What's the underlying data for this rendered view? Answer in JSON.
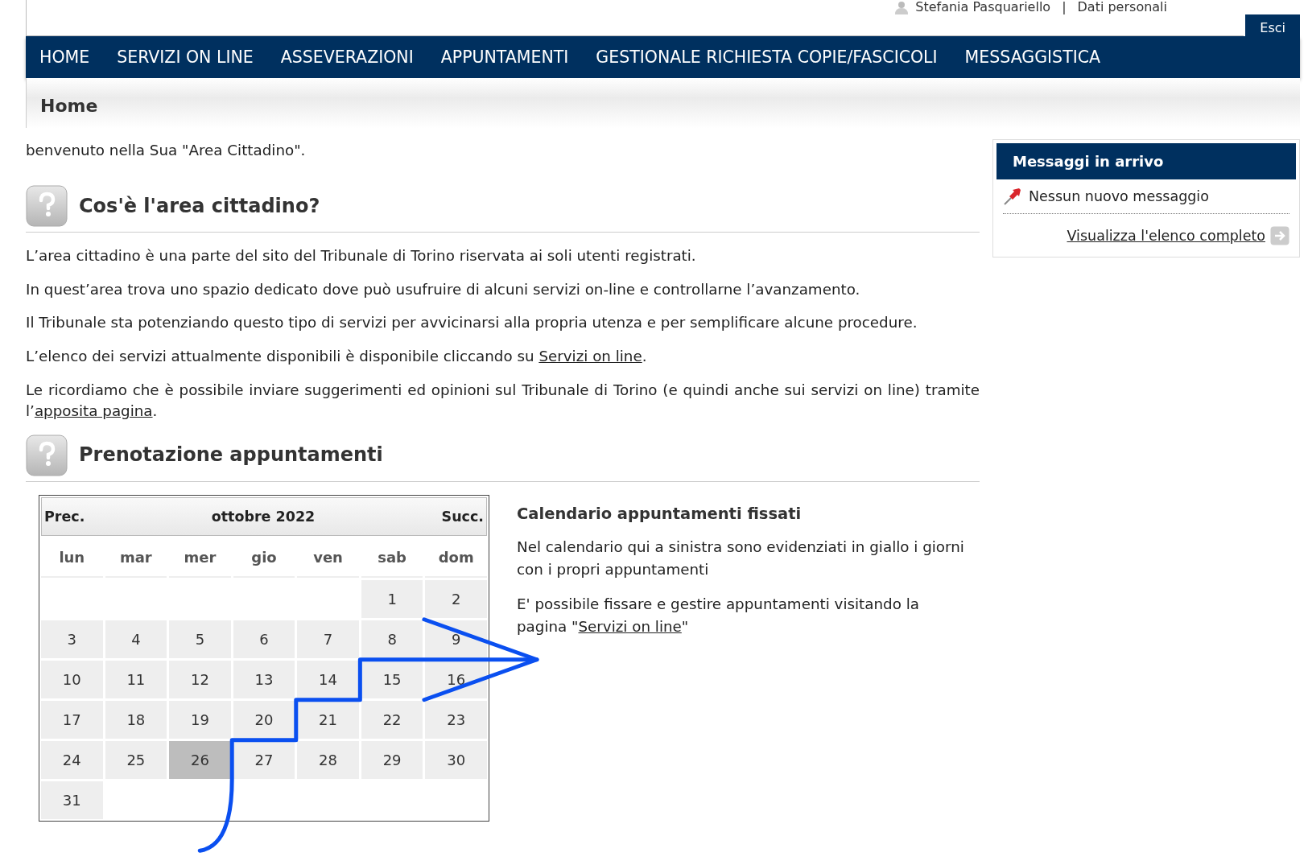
{
  "user_bar": {
    "user": "Stefania Pasquariello",
    "separator": "|",
    "link": "Dati personali",
    "logout": "Esci"
  },
  "nav": [
    {
      "label": "HOME"
    },
    {
      "label": "SERVIZI ON LINE"
    },
    {
      "label": "ASSEVERAZIONI"
    },
    {
      "label": "APPUNTAMENTI"
    },
    {
      "label": "GESTIONALE RICHIESTA COPIE/FASCICOLI"
    },
    {
      "label": "MESSAGGISTICA"
    }
  ],
  "page_title": "Home",
  "welcome": "benvenuto nella Sua \"Area Cittadino\".",
  "sections": [
    {
      "title": "Cos'è l'area cittadino?",
      "paragraphs": [
        [
          {
            "text": "L’area cittadino è una parte del sito del Tribunale di Torino riservata ai soli utenti registrati."
          }
        ],
        [
          {
            "text": "In quest’area trova uno spazio dedicato dove può usufruire di alcuni servizi on-line e controllarne l’avanzamento."
          }
        ],
        [
          {
            "text": "Il Tribunale sta potenziando questo tipo di servizi per avvicinarsi alla propria utenza e per semplificare alcune procedure."
          }
        ],
        [
          {
            "text": "L’elenco dei servizi attualmente disponibili è disponibile cliccando su "
          },
          {
            "text": "Servizi on line",
            "link": true
          },
          {
            "text": "."
          }
        ],
        [
          {
            "text": "Le ricordiamo che è possibile inviare suggerimenti ed opinioni sul Tribunale di Torino (e quindi anche sui servizi on line) tramite l’"
          },
          {
            "text": "apposita pagina",
            "link": true
          },
          {
            "text": "."
          }
        ]
      ]
    },
    {
      "title": "Prenotazione appuntamenti"
    }
  ],
  "calendar": {
    "prev": "Prec.",
    "month": "ottobre 2022",
    "next": "Succ.",
    "weekdays": [
      "lun",
      "mar",
      "mer",
      "gio",
      "ven",
      "sab",
      "dom"
    ],
    "days": [
      {
        "day": "1",
        "selected": false
      },
      {
        "day": "2",
        "selected": false
      },
      {
        "day": "3",
        "selected": false
      },
      {
        "day": "4",
        "selected": false
      },
      {
        "day": "5",
        "selected": false
      },
      {
        "day": "6",
        "selected": false
      },
      {
        "day": "7",
        "selected": false
      },
      {
        "day": "8",
        "selected": false
      },
      {
        "day": "9",
        "selected": false
      },
      {
        "day": "10",
        "selected": false
      },
      {
        "day": "11",
        "selected": false
      },
      {
        "day": "12",
        "selected": false
      },
      {
        "day": "13",
        "selected": false
      },
      {
        "day": "14",
        "selected": false
      },
      {
        "day": "15",
        "selected": false
      },
      {
        "day": "16",
        "selected": false
      },
      {
        "day": "17",
        "selected": false
      },
      {
        "day": "18",
        "selected": false
      },
      {
        "day": "19",
        "selected": false
      },
      {
        "day": "20",
        "selected": false
      },
      {
        "day": "21",
        "selected": false
      },
      {
        "day": "22",
        "selected": false
      },
      {
        "day": "23",
        "selected": false
      },
      {
        "day": "24",
        "selected": false
      },
      {
        "day": "25",
        "selected": false
      },
      {
        "day": "26",
        "selected": true
      },
      {
        "day": "27",
        "selected": false
      },
      {
        "day": "28",
        "selected": false
      },
      {
        "day": "29",
        "selected": false
      },
      {
        "day": "30",
        "selected": false
      },
      {
        "day": "31",
        "selected": false
      }
    ]
  },
  "calendar_info": {
    "title": "Calendario appuntamenti fissati",
    "paragraphs": [
      [
        {
          "text": "Nel calendario qui a sinistra sono evidenziati in giallo i giorni con i propri appuntamenti"
        }
      ],
      [
        {
          "text": "E' possibile fissare e gestire appuntamenti visitando la pagina \""
        },
        {
          "text": "Servizi on line",
          "link": true
        },
        {
          "text": "\""
        }
      ]
    ]
  },
  "inbox": {
    "title": "Messaggi in arrivo",
    "message": "Nessun nuovo messaggio",
    "link": "Visualizza l'elenco completo"
  }
}
